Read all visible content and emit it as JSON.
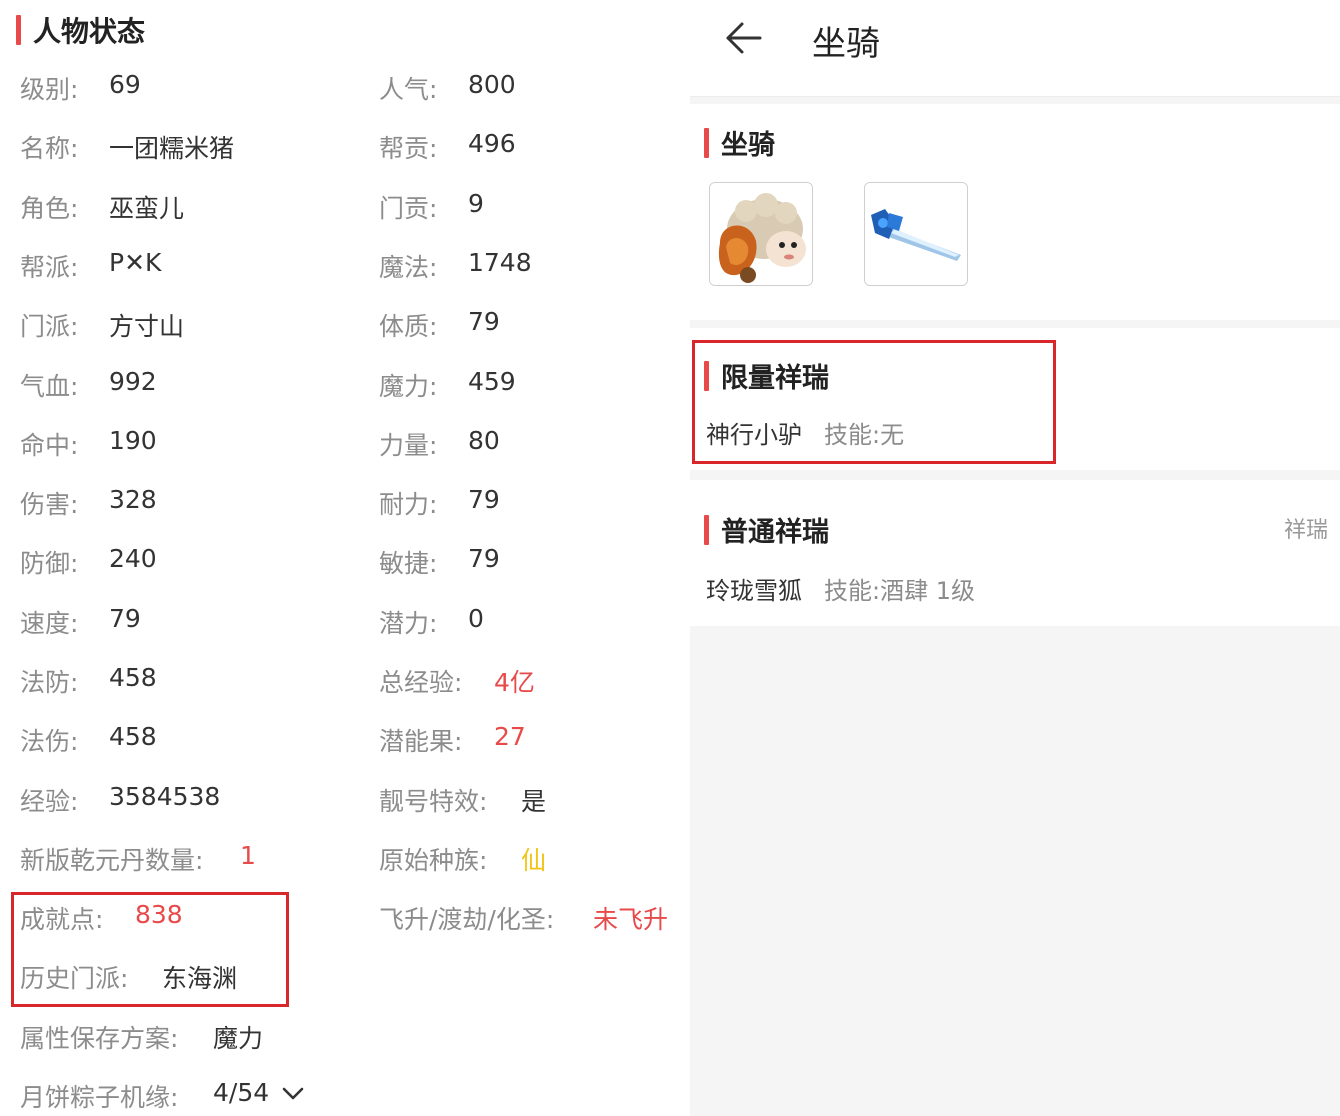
{
  "character": {
    "section_title": "人物状态",
    "left_column": [
      {
        "label": "级别:",
        "value": "69"
      },
      {
        "label": "名称:",
        "value": "一团糯米猪"
      },
      {
        "label": "角色:",
        "value": "巫蛮儿"
      },
      {
        "label": "帮派:",
        "value": "P✕K"
      },
      {
        "label": "门派:",
        "value": "方寸山"
      },
      {
        "label": "气血:",
        "value": "992"
      },
      {
        "label": "命中:",
        "value": "190"
      },
      {
        "label": "伤害:",
        "value": "328"
      },
      {
        "label": "防御:",
        "value": "240"
      },
      {
        "label": "速度:",
        "value": "79"
      },
      {
        "label": "法防:",
        "value": "458"
      },
      {
        "label": "法伤:",
        "value": "458"
      },
      {
        "label": "经验:",
        "value": "3584538"
      }
    ],
    "right_column": [
      {
        "label": "人气:",
        "value": "800"
      },
      {
        "label": "帮贡:",
        "value": "496"
      },
      {
        "label": "门贡:",
        "value": "9"
      },
      {
        "label": "魔法:",
        "value": "1748"
      },
      {
        "label": "体质:",
        "value": "79"
      },
      {
        "label": "魔力:",
        "value": "459"
      },
      {
        "label": "力量:",
        "value": "80"
      },
      {
        "label": "耐力:",
        "value": "79"
      },
      {
        "label": "敏捷:",
        "value": "79"
      },
      {
        "label": "潜力:",
        "value": "0"
      },
      {
        "label": "总经验:",
        "value": "4亿",
        "color": "#e84a4a"
      },
      {
        "label": "潜能果:",
        "value": "27",
        "color": "#e84a4a"
      },
      {
        "label": "靓号特效:",
        "value": "是"
      },
      {
        "label": "原始种族:",
        "value": "仙",
        "color": "#f2c416"
      },
      {
        "label": "飞升/渡劫/化圣:",
        "value": "未飞升",
        "color": "#e84a4a"
      }
    ],
    "qianyuandan": {
      "label": "新版乾元丹数量:",
      "value": "1"
    },
    "achievement": {
      "label": "成就点:",
      "value": "838"
    },
    "history_school": {
      "label": "历史门派:",
      "value": "东海渊"
    },
    "attr_plan": {
      "label": "属性保存方案:",
      "value": "魔力"
    },
    "mooncake": {
      "label": "月饼粽子机缘:",
      "value": "4/54"
    }
  },
  "mounts_page": {
    "title": "坐骑",
    "back_icon": "arrow-left-icon",
    "mounts_section_title": "坐骑",
    "mount_icons": [
      "sheep-mount-icon",
      "blue-sword-mount-icon"
    ],
    "limited": {
      "title": "限量祥瑞",
      "name": "神行小驴",
      "skill_label": "技能:",
      "skill_value": "无"
    },
    "normal": {
      "title": "普通祥瑞",
      "side_link": "祥瑞",
      "name": "玲珑雪狐",
      "skill_label": "技能:",
      "skill_value": "酒肆 1级"
    }
  },
  "colors": {
    "accent_red": "#e84a4a",
    "highlight_box": "#d9262b",
    "race_yellow": "#f2c416",
    "label_gray": "#8c8c8c"
  }
}
